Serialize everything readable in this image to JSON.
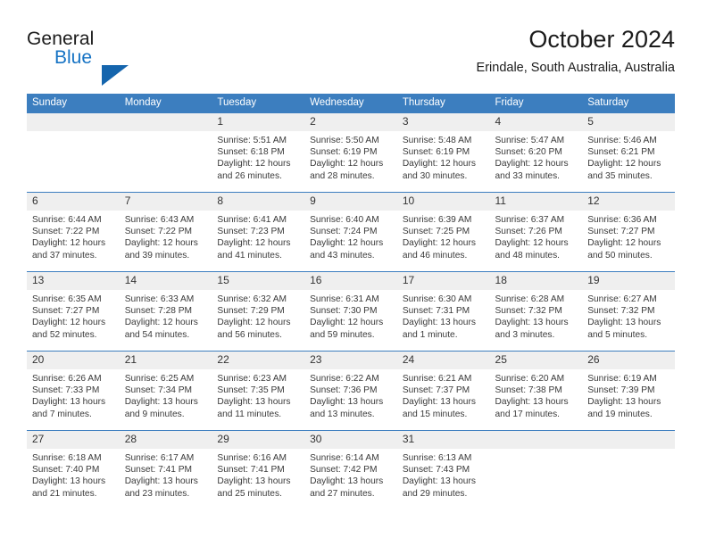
{
  "brand": {
    "name_line1": "General",
    "name_line2": "Blue",
    "triangle_color": "#1565ad",
    "blue_color": "#1673c4"
  },
  "header": {
    "title": "October 2024",
    "subtitle": "Erindale, South Australia, Australia"
  },
  "theme": {
    "header_blue": "#3c7ebf",
    "daynum_band": "#efefef",
    "text": "#3a3a3a"
  },
  "calendar": {
    "weekday_headers": [
      "Sunday",
      "Monday",
      "Tuesday",
      "Wednesday",
      "Thursday",
      "Friday",
      "Saturday"
    ],
    "weeks": [
      [
        {
          "day": "",
          "empty": true
        },
        {
          "day": "",
          "empty": true
        },
        {
          "day": "1",
          "sunrise": "Sunrise: 5:51 AM",
          "sunset": "Sunset: 6:18 PM",
          "daylight": "Daylight: 12 hours and 26 minutes."
        },
        {
          "day": "2",
          "sunrise": "Sunrise: 5:50 AM",
          "sunset": "Sunset: 6:19 PM",
          "daylight": "Daylight: 12 hours and 28 minutes."
        },
        {
          "day": "3",
          "sunrise": "Sunrise: 5:48 AM",
          "sunset": "Sunset: 6:19 PM",
          "daylight": "Daylight: 12 hours and 30 minutes."
        },
        {
          "day": "4",
          "sunrise": "Sunrise: 5:47 AM",
          "sunset": "Sunset: 6:20 PM",
          "daylight": "Daylight: 12 hours and 33 minutes."
        },
        {
          "day": "5",
          "sunrise": "Sunrise: 5:46 AM",
          "sunset": "Sunset: 6:21 PM",
          "daylight": "Daylight: 12 hours and 35 minutes."
        }
      ],
      [
        {
          "day": "6",
          "sunrise": "Sunrise: 6:44 AM",
          "sunset": "Sunset: 7:22 PM",
          "daylight": "Daylight: 12 hours and 37 minutes."
        },
        {
          "day": "7",
          "sunrise": "Sunrise: 6:43 AM",
          "sunset": "Sunset: 7:22 PM",
          "daylight": "Daylight: 12 hours and 39 minutes."
        },
        {
          "day": "8",
          "sunrise": "Sunrise: 6:41 AM",
          "sunset": "Sunset: 7:23 PM",
          "daylight": "Daylight: 12 hours and 41 minutes."
        },
        {
          "day": "9",
          "sunrise": "Sunrise: 6:40 AM",
          "sunset": "Sunset: 7:24 PM",
          "daylight": "Daylight: 12 hours and 43 minutes."
        },
        {
          "day": "10",
          "sunrise": "Sunrise: 6:39 AM",
          "sunset": "Sunset: 7:25 PM",
          "daylight": "Daylight: 12 hours and 46 minutes."
        },
        {
          "day": "11",
          "sunrise": "Sunrise: 6:37 AM",
          "sunset": "Sunset: 7:26 PM",
          "daylight": "Daylight: 12 hours and 48 minutes."
        },
        {
          "day": "12",
          "sunrise": "Sunrise: 6:36 AM",
          "sunset": "Sunset: 7:27 PM",
          "daylight": "Daylight: 12 hours and 50 minutes."
        }
      ],
      [
        {
          "day": "13",
          "sunrise": "Sunrise: 6:35 AM",
          "sunset": "Sunset: 7:27 PM",
          "daylight": "Daylight: 12 hours and 52 minutes."
        },
        {
          "day": "14",
          "sunrise": "Sunrise: 6:33 AM",
          "sunset": "Sunset: 7:28 PM",
          "daylight": "Daylight: 12 hours and 54 minutes."
        },
        {
          "day": "15",
          "sunrise": "Sunrise: 6:32 AM",
          "sunset": "Sunset: 7:29 PM",
          "daylight": "Daylight: 12 hours and 56 minutes."
        },
        {
          "day": "16",
          "sunrise": "Sunrise: 6:31 AM",
          "sunset": "Sunset: 7:30 PM",
          "daylight": "Daylight: 12 hours and 59 minutes."
        },
        {
          "day": "17",
          "sunrise": "Sunrise: 6:30 AM",
          "sunset": "Sunset: 7:31 PM",
          "daylight": "Daylight: 13 hours and 1 minute."
        },
        {
          "day": "18",
          "sunrise": "Sunrise: 6:28 AM",
          "sunset": "Sunset: 7:32 PM",
          "daylight": "Daylight: 13 hours and 3 minutes."
        },
        {
          "day": "19",
          "sunrise": "Sunrise: 6:27 AM",
          "sunset": "Sunset: 7:32 PM",
          "daylight": "Daylight: 13 hours and 5 minutes."
        }
      ],
      [
        {
          "day": "20",
          "sunrise": "Sunrise: 6:26 AM",
          "sunset": "Sunset: 7:33 PM",
          "daylight": "Daylight: 13 hours and 7 minutes."
        },
        {
          "day": "21",
          "sunrise": "Sunrise: 6:25 AM",
          "sunset": "Sunset: 7:34 PM",
          "daylight": "Daylight: 13 hours and 9 minutes."
        },
        {
          "day": "22",
          "sunrise": "Sunrise: 6:23 AM",
          "sunset": "Sunset: 7:35 PM",
          "daylight": "Daylight: 13 hours and 11 minutes."
        },
        {
          "day": "23",
          "sunrise": "Sunrise: 6:22 AM",
          "sunset": "Sunset: 7:36 PM",
          "daylight": "Daylight: 13 hours and 13 minutes."
        },
        {
          "day": "24",
          "sunrise": "Sunrise: 6:21 AM",
          "sunset": "Sunset: 7:37 PM",
          "daylight": "Daylight: 13 hours and 15 minutes."
        },
        {
          "day": "25",
          "sunrise": "Sunrise: 6:20 AM",
          "sunset": "Sunset: 7:38 PM",
          "daylight": "Daylight: 13 hours and 17 minutes."
        },
        {
          "day": "26",
          "sunrise": "Sunrise: 6:19 AM",
          "sunset": "Sunset: 7:39 PM",
          "daylight": "Daylight: 13 hours and 19 minutes."
        }
      ],
      [
        {
          "day": "27",
          "sunrise": "Sunrise: 6:18 AM",
          "sunset": "Sunset: 7:40 PM",
          "daylight": "Daylight: 13 hours and 21 minutes."
        },
        {
          "day": "28",
          "sunrise": "Sunrise: 6:17 AM",
          "sunset": "Sunset: 7:41 PM",
          "daylight": "Daylight: 13 hours and 23 minutes."
        },
        {
          "day": "29",
          "sunrise": "Sunrise: 6:16 AM",
          "sunset": "Sunset: 7:41 PM",
          "daylight": "Daylight: 13 hours and 25 minutes."
        },
        {
          "day": "30",
          "sunrise": "Sunrise: 6:14 AM",
          "sunset": "Sunset: 7:42 PM",
          "daylight": "Daylight: 13 hours and 27 minutes."
        },
        {
          "day": "31",
          "sunrise": "Sunrise: 6:13 AM",
          "sunset": "Sunset: 7:43 PM",
          "daylight": "Daylight: 13 hours and 29 minutes."
        },
        {
          "day": "",
          "empty": true
        },
        {
          "day": "",
          "empty": true
        }
      ]
    ]
  }
}
